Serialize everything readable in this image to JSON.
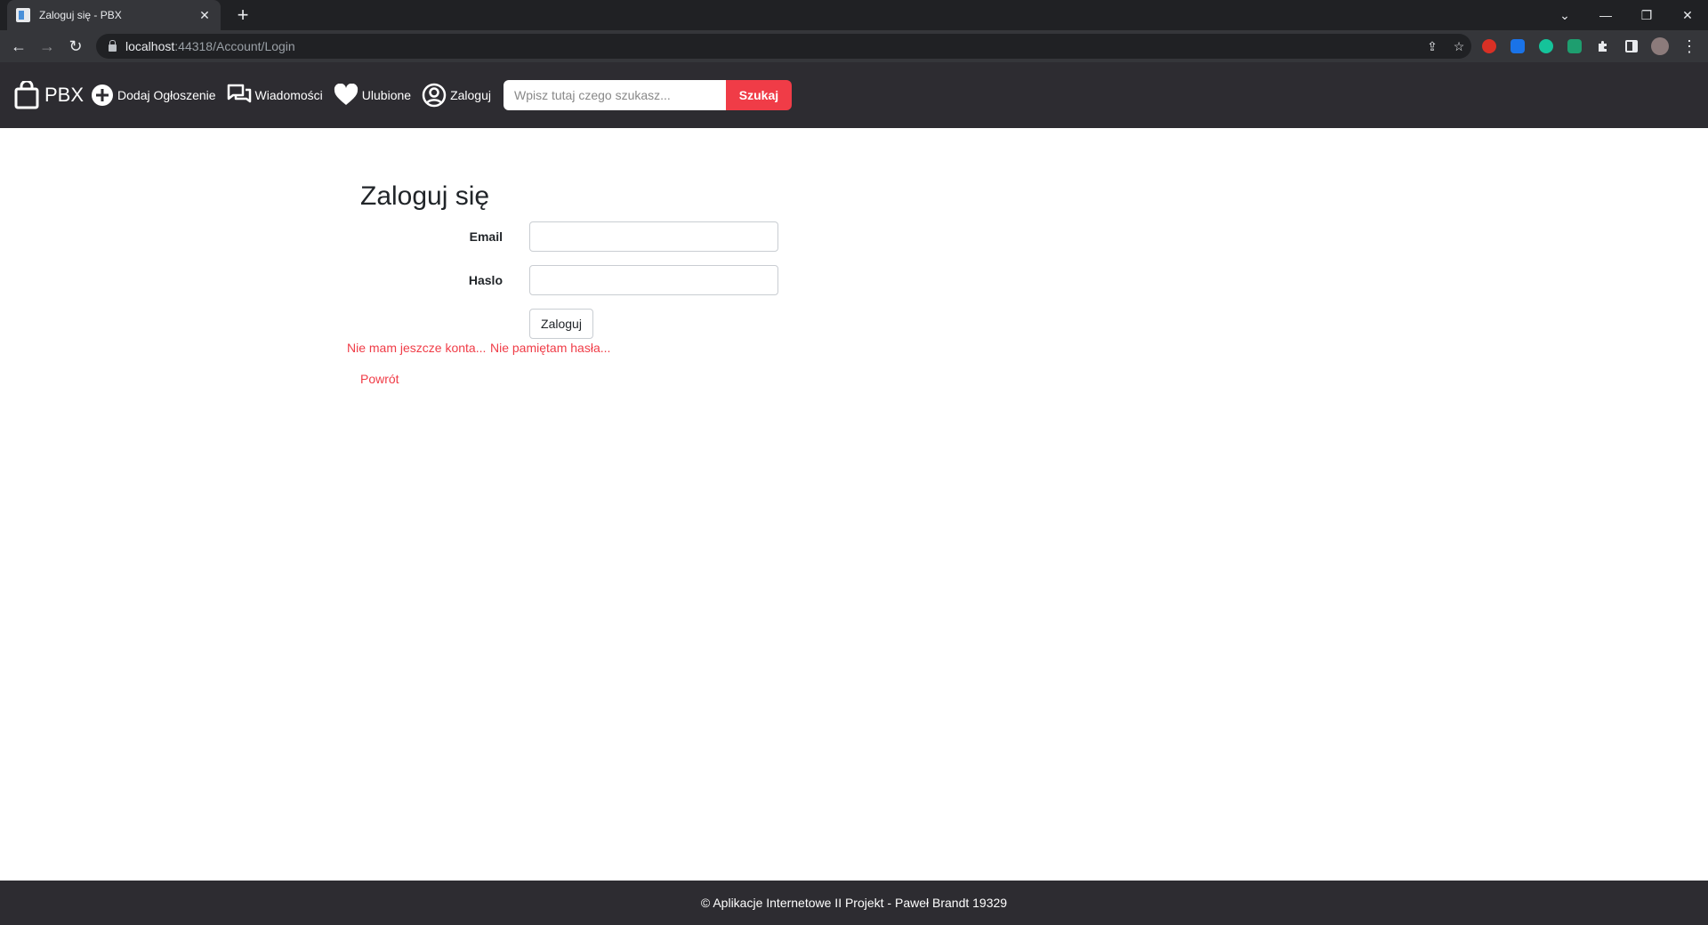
{
  "browser": {
    "tab_title": "Zaloguj się - PBX",
    "tab_close": "✕",
    "new_tab": "+",
    "url_host": "localhost",
    "url_rest": ":44318/Account/Login",
    "window_controls": {
      "tabs_menu": "⌄",
      "minimize": "—",
      "restore": "❐",
      "close": "✕"
    },
    "nav": {
      "back": "←",
      "forward": "→",
      "reload": "↻"
    },
    "icons": {
      "share": "⇪",
      "bookmark": "☆",
      "menu": "⋮"
    }
  },
  "navbar": {
    "brand": "PBX",
    "links": {
      "add_listing": "Dodaj Ogłoszenie",
      "messages": "Wiadomości",
      "favorites": "Ulubione",
      "login": "Zaloguj"
    },
    "search": {
      "placeholder": "Wpisz tutaj czego szukasz...",
      "button": "Szukaj"
    }
  },
  "login": {
    "title": "Zaloguj się",
    "email_label": "Email",
    "password_label": "Haslo",
    "submit": "Zaloguj",
    "no_account": "Nie mam jeszcze konta...",
    "forgot_password": "Nie pamiętam hasła...",
    "back": "Powrót"
  },
  "footer": {
    "text": "© Aplikacje Internetowe II Projekt - Paweł Brandt 19329"
  },
  "colors": {
    "accent": "#f03c47",
    "navbar_bg": "#2d2c31",
    "browser_bg": "#202124"
  }
}
